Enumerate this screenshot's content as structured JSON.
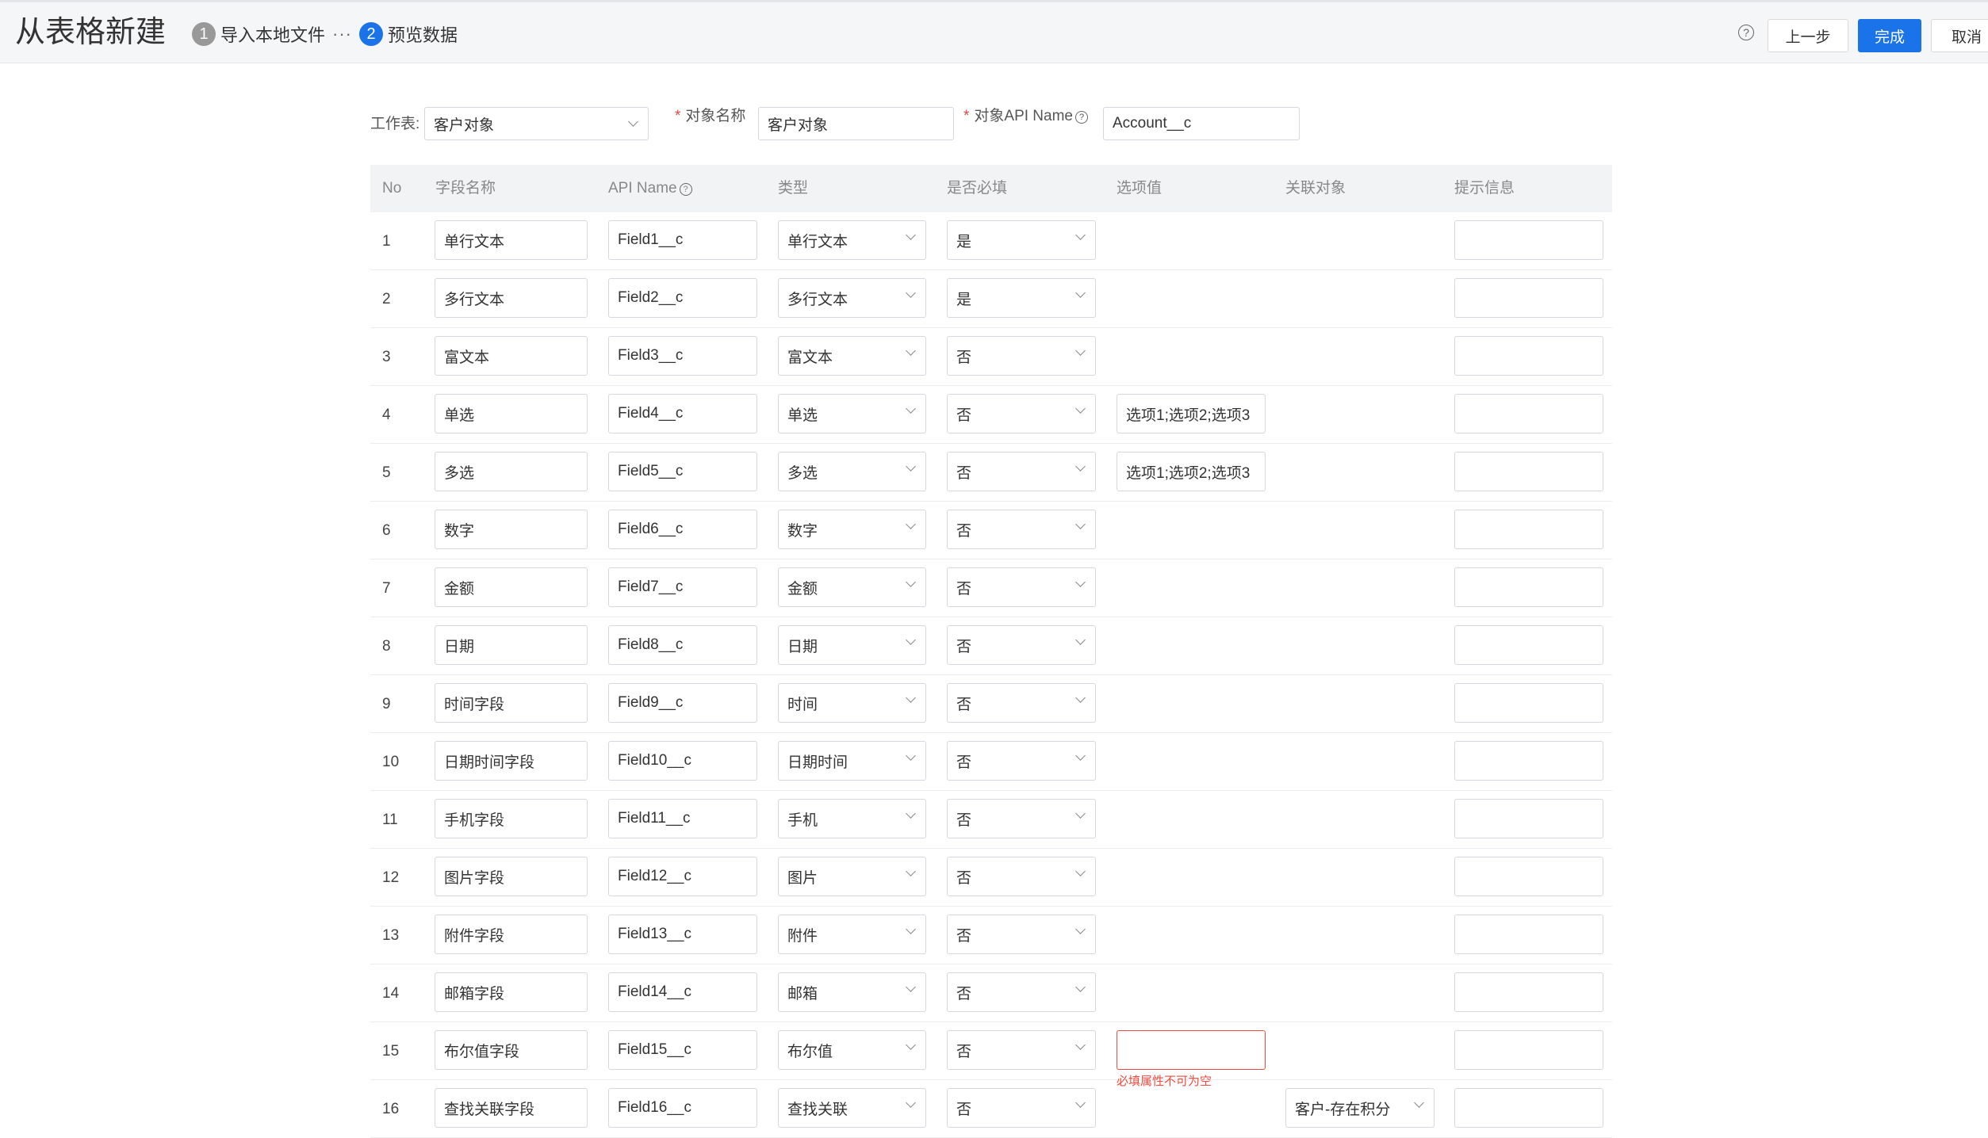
{
  "header": {
    "title": "从表格新建",
    "steps": [
      {
        "num": "1",
        "label": "导入本地文件"
      },
      {
        "num": "2",
        "label": "预览数据"
      }
    ],
    "separator": "···",
    "help_icon": "?",
    "buttons": {
      "prev": "上一步",
      "done": "完成",
      "cancel": "取消"
    }
  },
  "form": {
    "sheet_label": "工作表:",
    "sheet_value": "客户对象",
    "object_name_label": "对象名称",
    "object_name_value": "客户对象",
    "api_name_label": "对象API Name",
    "api_name_value": "Account__c",
    "required_mark": "*"
  },
  "table": {
    "columns": [
      "No",
      "字段名称",
      "API Name",
      "类型",
      "是否必填",
      "选项值",
      "关联对象",
      "提示信息"
    ],
    "rows": [
      {
        "no": "1",
        "name": "单行文本",
        "api": "Field1__c",
        "type": "单行文本",
        "required": "是"
      },
      {
        "no": "2",
        "name": "多行文本",
        "api": "Field2__c",
        "type": "多行文本",
        "required": "是"
      },
      {
        "no": "3",
        "name": "富文本",
        "api": "Field3__c",
        "type": "富文本",
        "required": "否"
      },
      {
        "no": "4",
        "name": "单选",
        "api": "Field4__c",
        "type": "单选",
        "required": "否",
        "options": "选项1;选项2;选项3"
      },
      {
        "no": "5",
        "name": "多选",
        "api": "Field5__c",
        "type": "多选",
        "required": "否",
        "options": "选项1;选项2;选项3"
      },
      {
        "no": "6",
        "name": "数字",
        "api": "Field6__c",
        "type": "数字",
        "required": "否"
      },
      {
        "no": "7",
        "name": "金额",
        "api": "Field7__c",
        "type": "金额",
        "required": "否"
      },
      {
        "no": "8",
        "name": "日期",
        "api": "Field8__c",
        "type": "日期",
        "required": "否"
      },
      {
        "no": "9",
        "name": "时间字段",
        "api": "Field9__c",
        "type": "时间",
        "required": "否"
      },
      {
        "no": "10",
        "name": "日期时间字段",
        "api": "Field10__c",
        "type": "日期时间",
        "required": "否"
      },
      {
        "no": "11",
        "name": "手机字段",
        "api": "Field11__c",
        "type": "手机",
        "required": "否"
      },
      {
        "no": "12",
        "name": "图片字段",
        "api": "Field12__c",
        "type": "图片",
        "required": "否"
      },
      {
        "no": "13",
        "name": "附件字段",
        "api": "Field13__c",
        "type": "附件",
        "required": "否"
      },
      {
        "no": "14",
        "name": "邮箱字段",
        "api": "Field14__c",
        "type": "邮箱",
        "required": "否"
      },
      {
        "no": "15",
        "name": "布尔值字段",
        "api": "Field15__c",
        "type": "布尔值",
        "required": "否",
        "options": "",
        "error": "必填属性不可为空"
      },
      {
        "no": "16",
        "name": "查找关联字段",
        "api": "Field16__c",
        "type": "查找关联",
        "required": "否",
        "related": "客户-存在积分"
      }
    ]
  }
}
